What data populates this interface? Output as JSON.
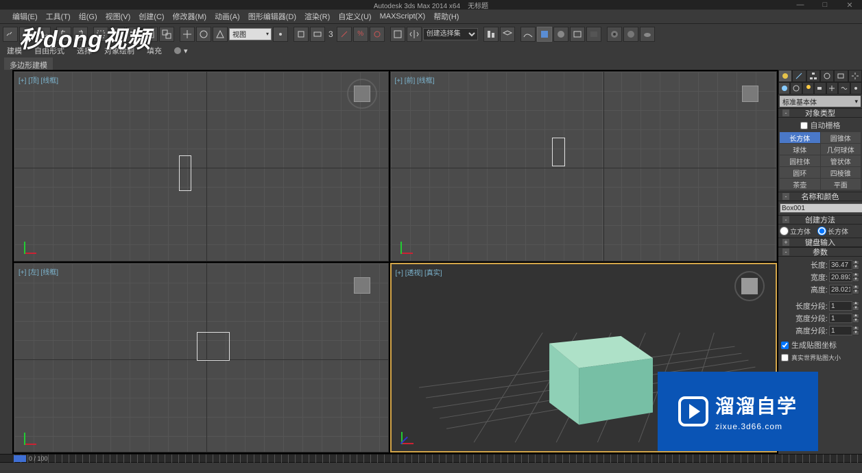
{
  "app": {
    "title": "Autodesk 3ds Max 2014 x64",
    "doc": "无标题"
  },
  "menu": {
    "items": [
      "编辑(E)",
      "工具(T)",
      "组(G)",
      "视图(V)",
      "创建(C)",
      "修改器(M)",
      "动画(A)",
      "图形编辑器(D)",
      "渲染(R)",
      "自定义(U)",
      "MAXScript(X)",
      "帮助(H)"
    ]
  },
  "maintoolbar": {
    "viewSystemLabel": "视图",
    "selectionSet": "创建选择集"
  },
  "secondbar": {
    "items": [
      "建模",
      "自由形式",
      "选择",
      "对象绘制",
      "填充"
    ]
  },
  "ribbonTab": "多边形建模",
  "viewports": {
    "tl": {
      "plus": "[+]",
      "name": "[顶]",
      "mode": "[线框]"
    },
    "tr": {
      "plus": "[+]",
      "name": "[前]",
      "mode": "[线框]"
    },
    "bl": {
      "plus": "[+]",
      "name": "[左]",
      "mode": "[线框]"
    },
    "br": {
      "plus": "[+]",
      "name": "[透视]",
      "mode": "[真实]"
    }
  },
  "commandpanel": {
    "category": "标准基本体",
    "rollouts": {
      "objectType": "对象类型",
      "autoGrid": "自动栅格",
      "nameColor": "名称和颜色",
      "createMethod": "创建方法",
      "keyboardEntry": "键盘输入",
      "params": "参数"
    },
    "primitives": {
      "box": "长方体",
      "cone": "圆锥体",
      "sphere": "球体",
      "geosphere": "几何球体",
      "cylinder": "圆柱体",
      "tube": "管状体",
      "torus": "圆环",
      "pyramid": "四棱锥",
      "teapot": "茶壶",
      "plane": "平面"
    },
    "objectName": "Box001",
    "createMethod": {
      "cube": "立方体",
      "box": "长方体"
    },
    "params": {
      "lengthLabel": "长度:",
      "length": "36.47",
      "widthLabel": "宽度:",
      "width": "20.893",
      "heightLabel": "高度:",
      "height": "28.021",
      "lsegLabel": "长度分段:",
      "lseg": "1",
      "wsegLabel": "宽度分段:",
      "wseg": "1",
      "hsegLabel": "高度分段:",
      "hseg": "1",
      "genMapLabel": "生成贴图坐标",
      "realWorldLabel": "真实世界贴图大小"
    }
  },
  "timeline": {
    "frameLabel": "0 / 100"
  },
  "watermarks": {
    "top": "秒dong视频",
    "bottomBig": "溜溜自学",
    "bottomSmall": "zixue.3d66.com"
  }
}
